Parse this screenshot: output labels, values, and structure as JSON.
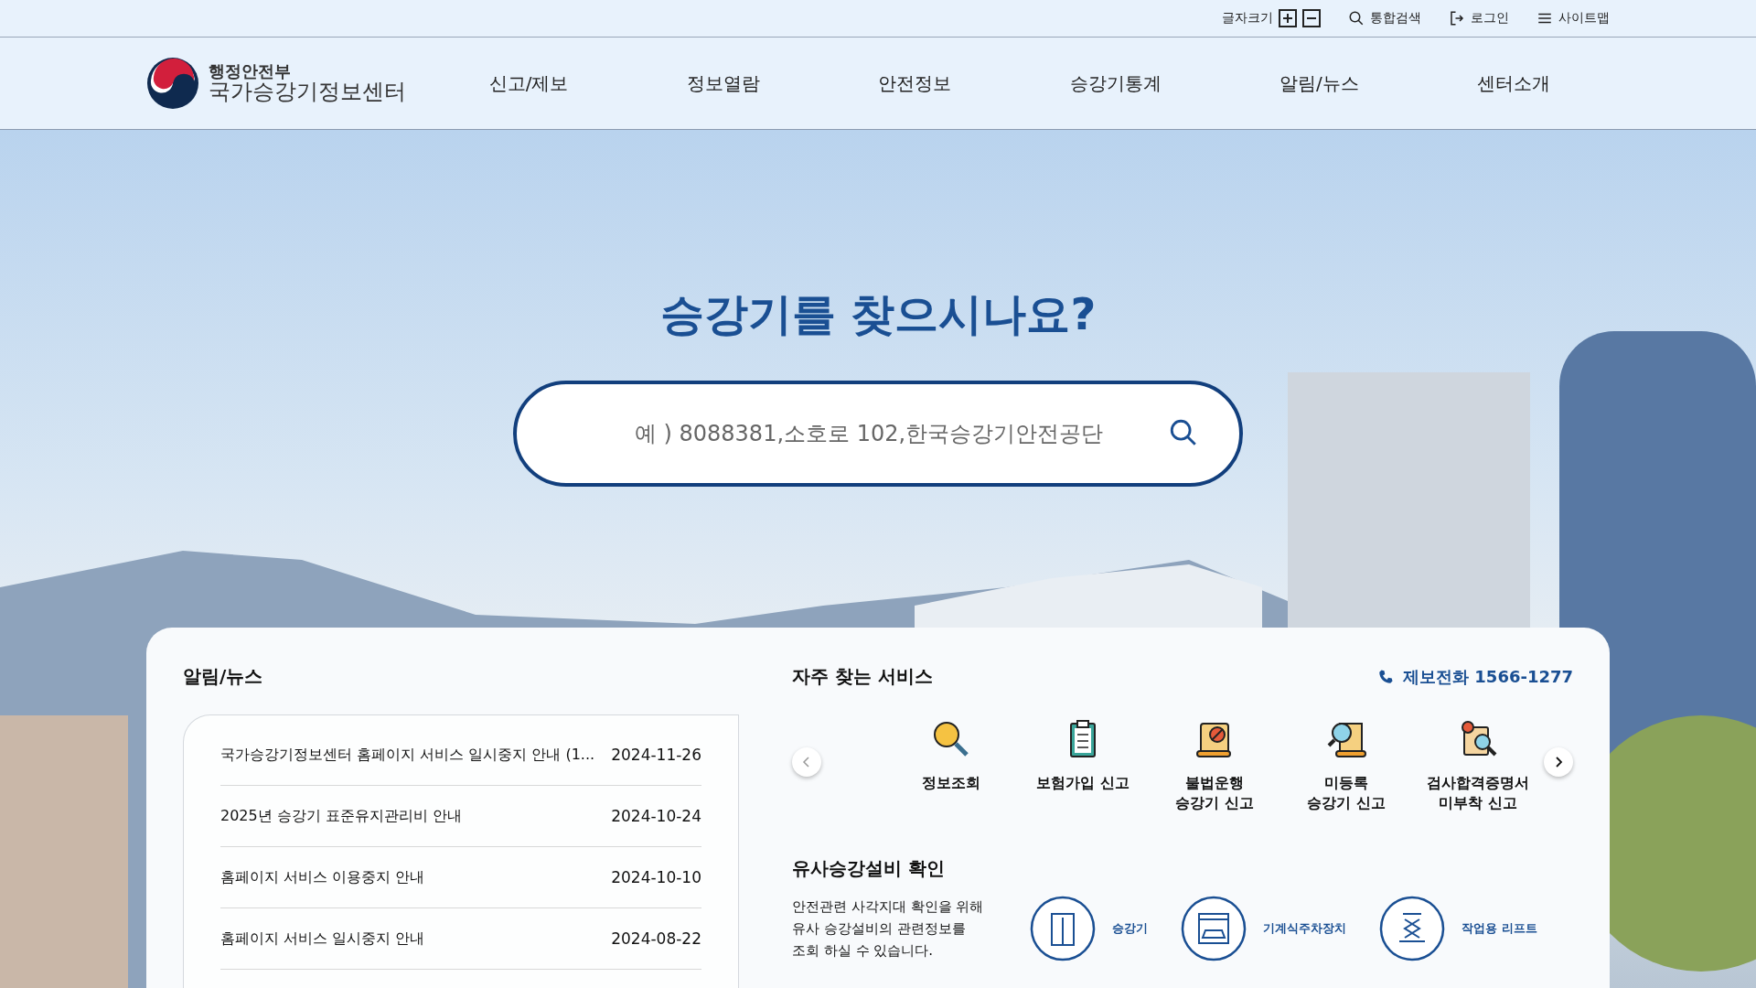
{
  "top_bar": {
    "font_size_label": "글자크기",
    "links": [
      {
        "kind": "search",
        "label": "통합검색"
      },
      {
        "kind": "login",
        "label": "로그인"
      },
      {
        "kind": "sitemap",
        "label": "사이트맵"
      }
    ]
  },
  "header": {
    "logo": {
      "ministry": "행정안전부",
      "center": "국가승강기정보센터"
    },
    "nav": [
      "신고/제보",
      "정보열람",
      "안전정보",
      "승강기통계",
      "알림/뉴스",
      "센터소개"
    ]
  },
  "hero": {
    "title": "승강기를 찾으시나요?",
    "search": {
      "placeholder": "예 ) 8088381,소호로 102,한국승강기안전공단"
    }
  },
  "news": {
    "title": "알림/뉴스",
    "items": [
      {
        "title": "국가승강기정보센터 홈페이지 서비스 일시중지 안내 (1...",
        "date": "2024-11-26"
      },
      {
        "title": "2025년 승강기 표준유지관리비 안내",
        "date": "2024-10-24"
      },
      {
        "title": "홈페이지 서비스 이용중지 안내",
        "date": "2024-10-10"
      },
      {
        "title": "홈페이지 서비스 일시중지 안내",
        "date": "2024-08-22"
      }
    ]
  },
  "services": {
    "title": "자주 찾는 서비스",
    "hotline": "제보전화 1566-1277",
    "items": [
      {
        "kind": "search",
        "label": "정보조회"
      },
      {
        "kind": "clipboard",
        "label": "보험가입 신고"
      },
      {
        "kind": "scroll",
        "label": "불법운행\n승강기 신고"
      },
      {
        "kind": "question",
        "label": "미등록\n승강기 신고"
      },
      {
        "kind": "certificate",
        "label": "검사합격증명서\n미부착 신고"
      }
    ]
  },
  "similar": {
    "title": "유사승강설비 확인",
    "description": "안전관련 사각지대 확인을 위해\n유사 승강설비의 관련정보를\n조회 하실 수 있습니다.",
    "items": [
      {
        "kind": "elevator",
        "label": "승강기"
      },
      {
        "kind": "parking",
        "label": "기계식주차장치"
      },
      {
        "kind": "lift",
        "label": "작업용 리프트"
      }
    ]
  }
}
